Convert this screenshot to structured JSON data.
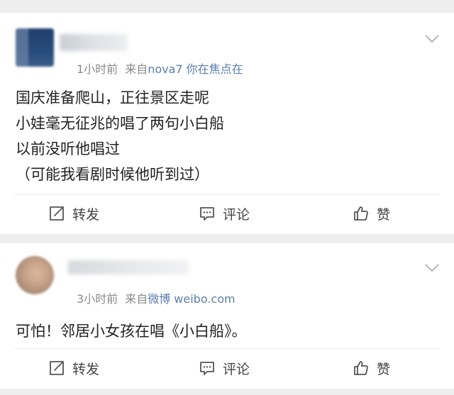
{
  "posts": [
    {
      "time": "1小时前",
      "source_prefix": "来自",
      "source": "nova7 你在焦点在",
      "lines": [
        "国庆准备爬山，正往景区走呢",
        "小娃毫无征兆的唱了两句小白船",
        "以前没听他唱过",
        "（可能我看剧时候他听到过）"
      ],
      "actions": {
        "repost": "转发",
        "comment": "评论",
        "like": "赞"
      }
    },
    {
      "time": "3小时前",
      "source_prefix": "来自",
      "source": "微博 weibo.com",
      "lines": [
        "可怕！邻居小女孩在唱《小白船》。"
      ],
      "actions": {
        "repost": "转发",
        "comment": "评论",
        "like": "赞"
      }
    }
  ],
  "icons": {
    "repost": "repost-icon",
    "comment": "comment-icon",
    "like": "thumbs-up-icon",
    "more": "chevron-down-icon"
  },
  "colors": {
    "source_link": "#5b7fad",
    "meta": "#8a8a8a",
    "text": "#222222",
    "background": "#eeeeee"
  }
}
